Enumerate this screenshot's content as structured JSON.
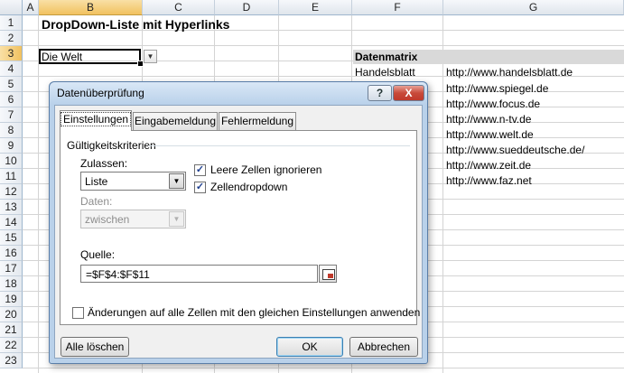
{
  "columns": [
    "A",
    "B",
    "C",
    "D",
    "E",
    "F",
    "G"
  ],
  "rows": [
    "1",
    "2",
    "3",
    "4",
    "5",
    "6",
    "7",
    "8",
    "9",
    "10",
    "11",
    "12",
    "13",
    "14",
    "15",
    "16",
    "17",
    "18",
    "19",
    "20",
    "21",
    "22",
    "23"
  ],
  "title": "DropDown-Liste mit Hyperlinks",
  "dropdown_cell": "Die Welt",
  "matrix_header": "Datenmatrix",
  "matrix_first_name": "Handelsblatt",
  "urls": [
    "http://www.handelsblatt.de",
    "http://www.spiegel.de",
    "http://www.focus.de",
    "http://www.n-tv.de",
    "http://www.welt.de",
    "http://www.sueddeutsche.de/",
    "http://www.zeit.de",
    "http://www.faz.net"
  ],
  "dialog": {
    "title": "Datenüberprüfung",
    "help_label": "?",
    "close_label": "X",
    "tabs": [
      "Einstellungen",
      "Eingabemeldung",
      "Fehlermeldung"
    ],
    "group_label": "Gültigkeitskriterien",
    "allow_label": "Zulassen:",
    "allow_value": "Liste",
    "data_label": "Daten:",
    "data_value": "zwischen",
    "ignore_blank": "Leere Zellen ignorieren",
    "in_cell_dropdown": "Zellendropdown",
    "source_label": "Quelle:",
    "source_value": "=$F$4:$F$11",
    "apply_all": "Änderungen auf alle Zellen mit den gleichen Einstellungen anwenden",
    "clear_all": "Alle löschen",
    "ok": "OK",
    "cancel": "Abbrechen"
  }
}
